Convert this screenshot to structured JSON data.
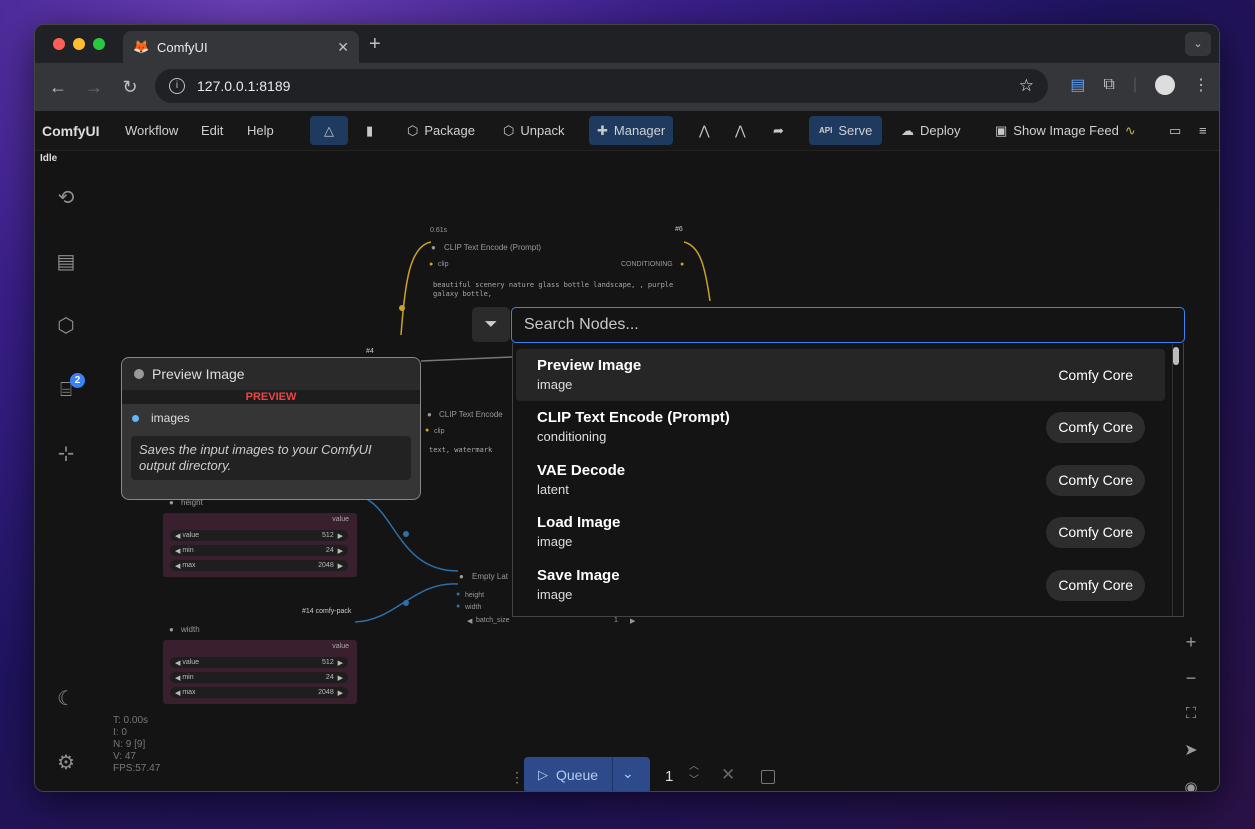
{
  "browser": {
    "tab_title": "ComfyUI",
    "url": "127.0.0.1:8189"
  },
  "menubar": {
    "logo": "ComfyUI",
    "workflow": "Workflow",
    "edit": "Edit",
    "help": "Help",
    "package": "Package",
    "unpack": "Unpack",
    "manager": "Manager",
    "serve": "Serve",
    "api_tag": "API",
    "deploy": "Deploy",
    "show_image_feed": "Show Image Feed"
  },
  "status": "Idle",
  "sidebar": {
    "badge_count": "2"
  },
  "stats": [
    "T: 0.00s",
    "I: 0",
    "N: 9 [9]",
    "V: 47",
    "FPS:57.47"
  ],
  "graph": {
    "clip_node1": {
      "time": "0.61s",
      "id": "#6",
      "title": "CLIP Text Encode (Prompt)",
      "input": "clip",
      "output": "CONDITIONING",
      "text": "beautiful scenery nature glass bottle landscape, , purple galaxy bottle,"
    },
    "clip_node2": {
      "id": "#4",
      "title": "CLIP Text Encode",
      "input": "clip",
      "text": "text, watermark"
    },
    "height_node": {
      "label": "height",
      "value_label": "value",
      "rows": [
        {
          "k": "value",
          "v": "512"
        },
        {
          "k": "min",
          "v": "24"
        },
        {
          "k": "max",
          "v": "2048"
        }
      ]
    },
    "width_node": {
      "id": "#14 comfy-pack",
      "label": "width",
      "value_label": "value",
      "rows": [
        {
          "k": "value",
          "v": "512"
        },
        {
          "k": "min",
          "v": "24"
        },
        {
          "k": "max",
          "v": "2048"
        }
      ]
    },
    "empty_latent": {
      "title": "Empty Lat",
      "in_height": "height",
      "in_width": "width",
      "batch_label": "batch_size",
      "batch_value": "1"
    }
  },
  "preview_node": {
    "title": "Preview Image",
    "tag": "PREVIEW",
    "input": "images",
    "description": "Saves the input images to your ComfyUI output directory."
  },
  "search": {
    "placeholder": "Search Nodes...",
    "results": [
      {
        "name": "Preview Image",
        "category": "image",
        "source": "Comfy Core"
      },
      {
        "name": "CLIP Text Encode (Prompt)",
        "category": "conditioning",
        "source": "Comfy Core"
      },
      {
        "name": "VAE Decode",
        "category": "latent",
        "source": "Comfy Core"
      },
      {
        "name": "Load Image",
        "category": "image",
        "source": "Comfy Core"
      },
      {
        "name": "Save Image",
        "category": "image",
        "source": "Comfy Core"
      }
    ]
  },
  "queue": {
    "label": "Queue",
    "count": "1"
  }
}
